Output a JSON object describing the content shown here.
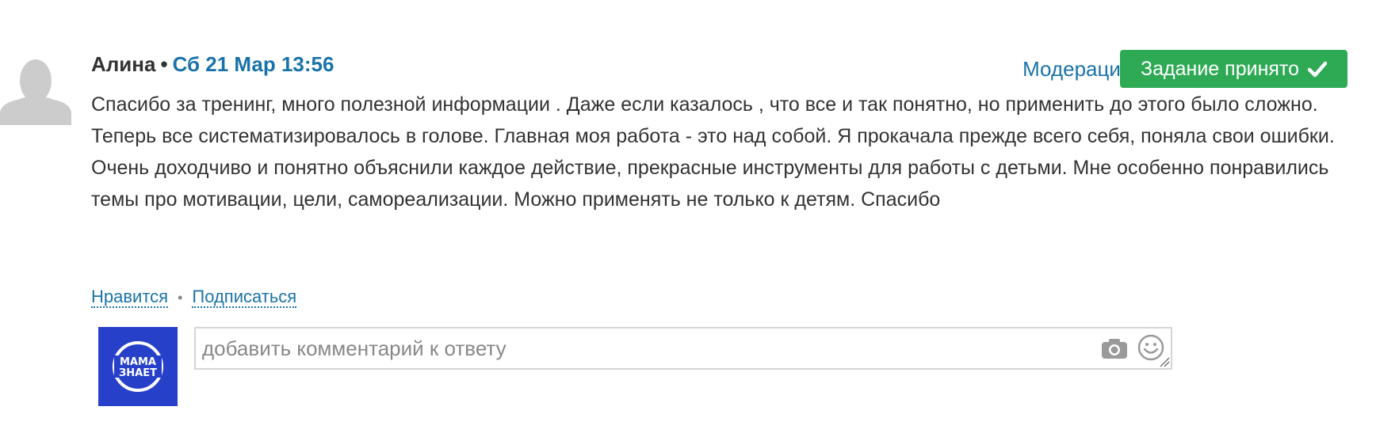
{
  "post": {
    "author": "Алина",
    "separator": "•",
    "date": "Сб 21 Мар 13:56",
    "avatar_icon": "default-user-avatar-icon",
    "text": "Спасибо за тренинг, много полезной информации . Даже если казалось , что все и так понятно, но применить до этого было сложно. Теперь все систематизировалось в голове. Главная моя работа - это над собой. Я прокачала прежде всего себя, поняла свои ошибки. Очень доходчиво и понятно объяснили каждое действие, прекрасные инструменты для работы с детьми. Мне особенно понравились темы про мотивации, цели, самореализации. Можно применять не только к детям. Спасибо"
  },
  "toolbar": {
    "moderation_label": "Модерация",
    "accepted_label": "Задание принято",
    "accepted_icon": "check-icon",
    "accepted_color": "#2eaa55"
  },
  "actions": {
    "like_label": "Нравится",
    "dot": "•",
    "subscribe_label": "Подписаться"
  },
  "comment": {
    "avatar_text_line1": "МАМА",
    "avatar_text_line2": "ЗНАЕТ",
    "avatar_color": "#2740c9",
    "placeholder": "добавить комментарий к ответу",
    "camera_icon": "camera-icon",
    "emoji_icon": "smile-icon"
  },
  "colors": {
    "link": "#1a73a8",
    "text": "#333333"
  }
}
